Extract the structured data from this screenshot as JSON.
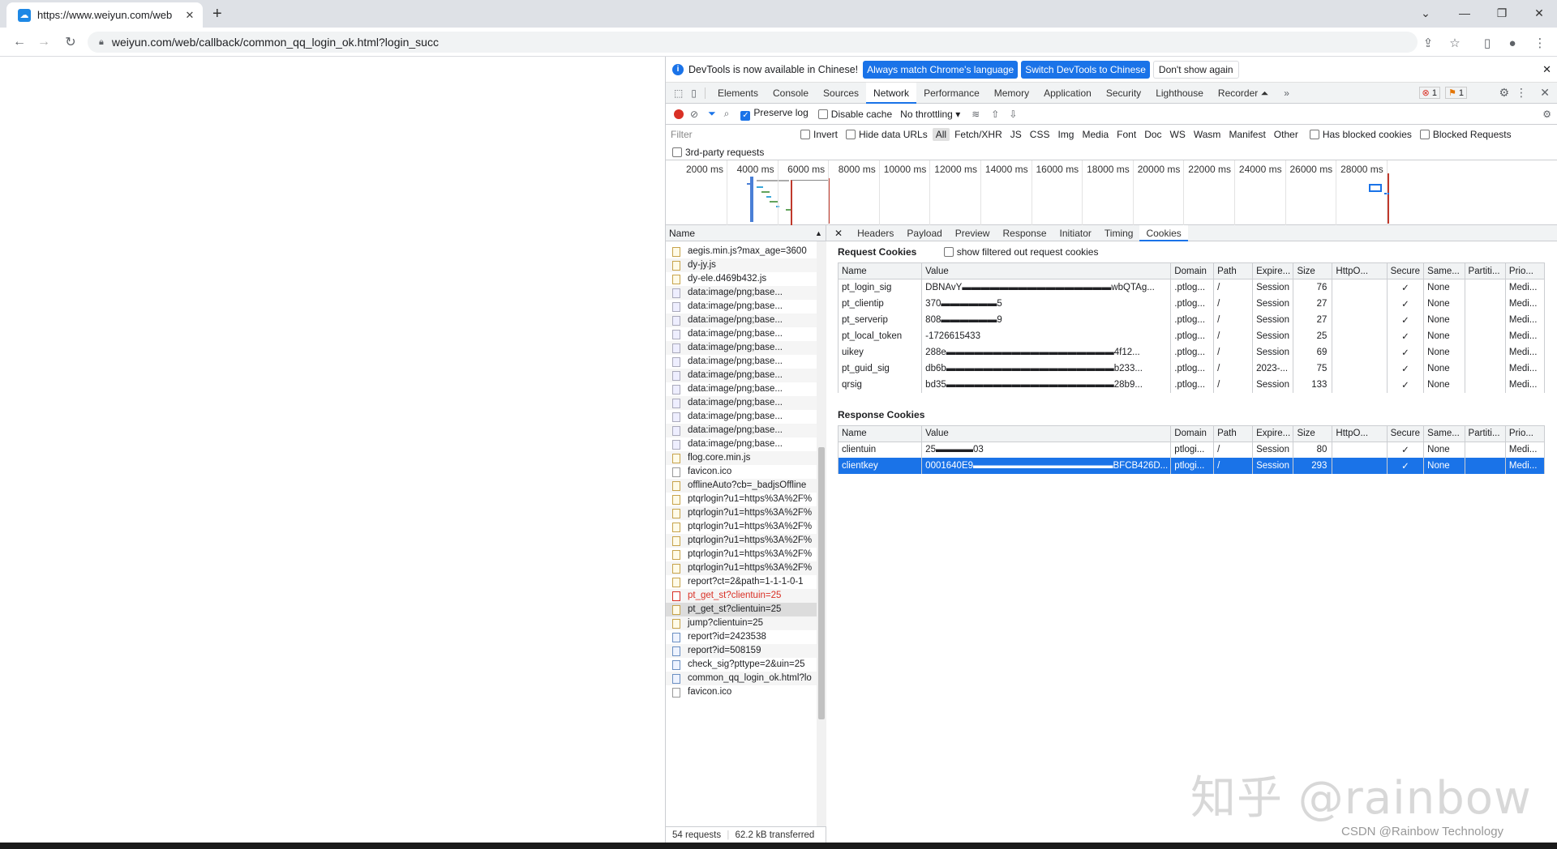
{
  "browser": {
    "tab_title": "https://www.weiyun.com/web",
    "tab_close": "✕",
    "new_tab": "+",
    "address": "weiyun.com/web/callback/common_qq_login_ok.html?login_succ"
  },
  "infobar": {
    "message": "DevTools is now available in Chinese!",
    "btn_match": "Always match Chrome's language",
    "btn_switch": "Switch DevTools to Chinese",
    "btn_dont": "Don't show again"
  },
  "devtools_tabs": [
    "Elements",
    "Console",
    "Sources",
    "Network",
    "Performance",
    "Memory",
    "Application",
    "Security",
    "Lighthouse",
    "Recorder ⏶"
  ],
  "badges": {
    "errors": "1",
    "warnings": "1"
  },
  "network_toolbar": {
    "preserve_log": "Preserve log",
    "disable_cache": "Disable cache",
    "throttling": "No throttling"
  },
  "filter": {
    "placeholder": "Filter",
    "invert": "Invert",
    "hide_data_urls": "Hide data URLs",
    "types": [
      "All",
      "Fetch/XHR",
      "JS",
      "CSS",
      "Img",
      "Media",
      "Font",
      "Doc",
      "WS",
      "Wasm",
      "Manifest",
      "Other"
    ],
    "has_blocked": "Has blocked cookies",
    "blocked_requests": "Blocked Requests",
    "third_party": "3rd-party requests"
  },
  "timeline_ticks": [
    "2000 ms",
    "4000 ms",
    "6000 ms",
    "8000 ms",
    "10000 ms",
    "12000 ms",
    "14000 ms",
    "16000 ms",
    "18000 ms",
    "20000 ms",
    "22000 ms",
    "24000 ms",
    "26000 ms",
    "28000 ms"
  ],
  "requests": {
    "header": "Name",
    "items": [
      {
        "name": "aegis.min.js?max_age=3600",
        "type": "js"
      },
      {
        "name": "dy-jy.js",
        "type": "js"
      },
      {
        "name": "dy-ele.d469b432.js",
        "type": "js"
      },
      {
        "name": "data:image/png;base...",
        "type": "img"
      },
      {
        "name": "data:image/png;base...",
        "type": "img"
      },
      {
        "name": "data:image/png;base...",
        "type": "img"
      },
      {
        "name": "data:image/png;base...",
        "type": "img"
      },
      {
        "name": "data:image/png;base...",
        "type": "img"
      },
      {
        "name": "data:image/png;base...",
        "type": "img"
      },
      {
        "name": "data:image/png;base...",
        "type": "img"
      },
      {
        "name": "data:image/png;base...",
        "type": "img"
      },
      {
        "name": "data:image/png;base...",
        "type": "img"
      },
      {
        "name": "data:image/png;base...",
        "type": "img"
      },
      {
        "name": "data:image/png;base...",
        "type": "img"
      },
      {
        "name": "data:image/png;base...",
        "type": "img"
      },
      {
        "name": "flog.core.min.js",
        "type": "js"
      },
      {
        "name": "favicon.ico",
        "type": "plain"
      },
      {
        "name": "offlineAuto?cb=_badjsOffline",
        "type": "js"
      },
      {
        "name": "ptqrlogin?u1=https%3A%2F%",
        "type": "js"
      },
      {
        "name": "ptqrlogin?u1=https%3A%2F%",
        "type": "js"
      },
      {
        "name": "ptqrlogin?u1=https%3A%2F%",
        "type": "js"
      },
      {
        "name": "ptqrlogin?u1=https%3A%2F%",
        "type": "js"
      },
      {
        "name": "ptqrlogin?u1=https%3A%2F%",
        "type": "js"
      },
      {
        "name": "ptqrlogin?u1=https%3A%2F%",
        "type": "js"
      },
      {
        "name": "report?ct=2&path=1-1-1-0-1",
        "type": "js"
      },
      {
        "name": "pt_get_st?clientuin=25",
        "type": "err"
      },
      {
        "name": "pt_get_st?clientuin=25",
        "type": "sel"
      },
      {
        "name": "jump?clientuin=25",
        "type": "js"
      },
      {
        "name": "report?id=2423538",
        "type": "doc"
      },
      {
        "name": "report?id=508159",
        "type": "doc"
      },
      {
        "name": "check_sig?pttype=2&uin=25",
        "type": "doc"
      },
      {
        "name": "common_qq_login_ok.html?lo",
        "type": "doc"
      },
      {
        "name": "favicon.ico",
        "type": "plain"
      }
    ],
    "footer_count": "54 requests",
    "footer_transfer": "62.2 kB transferred"
  },
  "detail_tabs": [
    "Headers",
    "Payload",
    "Preview",
    "Response",
    "Initiator",
    "Timing",
    "Cookies"
  ],
  "cookies": {
    "request_title": "Request Cookies",
    "show_filtered": "show filtered out request cookies",
    "response_title": "Response Cookies",
    "columns": [
      "Name",
      "Value",
      "Domain",
      "Path",
      "Expire...",
      "Size",
      "HttpO...",
      "Secure",
      "Same...",
      "Partiti...",
      "Prio..."
    ],
    "request_rows": [
      {
        "name": "pt_login_sig",
        "value": "DBNAvY▬▬▬▬▬▬▬▬▬▬▬▬▬▬▬▬wbQTAg...",
        "domain": ".ptlog...",
        "path": "/",
        "expires": "Session",
        "size": "76",
        "secure": "✓",
        "same": "None",
        "prio": "Medi..."
      },
      {
        "name": "pt_clientip",
        "value": "370▬▬▬▬▬▬5",
        "domain": ".ptlog...",
        "path": "/",
        "expires": "Session",
        "size": "27",
        "secure": "✓",
        "same": "None",
        "prio": "Medi..."
      },
      {
        "name": "pt_serverip",
        "value": "808▬▬▬▬▬▬9",
        "domain": ".ptlog...",
        "path": "/",
        "expires": "Session",
        "size": "27",
        "secure": "✓",
        "same": "None",
        "prio": "Medi..."
      },
      {
        "name": "pt_local_token",
        "value": "-1726615433",
        "domain": ".ptlog...",
        "path": "/",
        "expires": "Session",
        "size": "25",
        "secure": "✓",
        "same": "None",
        "prio": "Medi..."
      },
      {
        "name": "uikey",
        "value": "288e▬▬▬▬▬▬▬▬▬▬▬▬▬▬▬▬▬▬4f12...",
        "domain": ".ptlog...",
        "path": "/",
        "expires": "Session",
        "size": "69",
        "secure": "✓",
        "same": "None",
        "prio": "Medi..."
      },
      {
        "name": "pt_guid_sig",
        "value": "db6b▬▬▬▬▬▬▬▬▬▬▬▬▬▬▬▬▬▬b233...",
        "domain": ".ptlog...",
        "path": "/",
        "expires": "2023-...",
        "size": "75",
        "secure": "✓",
        "same": "None",
        "prio": "Medi..."
      },
      {
        "name": "qrsig",
        "value": "bd35▬▬▬▬▬▬▬▬▬▬▬▬▬▬▬▬▬▬28b9...",
        "domain": ".ptlog...",
        "path": "/",
        "expires": "Session",
        "size": "133",
        "secure": "✓",
        "same": "None",
        "prio": "Medi..."
      }
    ],
    "response_rows": [
      {
        "name": "clientuin",
        "value": "25▬▬▬▬03",
        "domain": "ptlogi...",
        "path": "/",
        "expires": "Session",
        "size": "80",
        "secure": "✓",
        "same": "None",
        "prio": "Medi...",
        "selected": false
      },
      {
        "name": "clientkey",
        "value": "0001640E9▬▬▬▬▬▬▬▬▬▬▬▬▬▬▬BFCB426D...",
        "domain": "ptlogi...",
        "path": "/",
        "expires": "Session",
        "size": "293",
        "secure": "✓",
        "same": "None",
        "prio": "Medi...",
        "selected": true
      }
    ]
  },
  "watermark": "知乎 @rainbow",
  "csdn_mark": "CSDN @Rainbow Technology"
}
